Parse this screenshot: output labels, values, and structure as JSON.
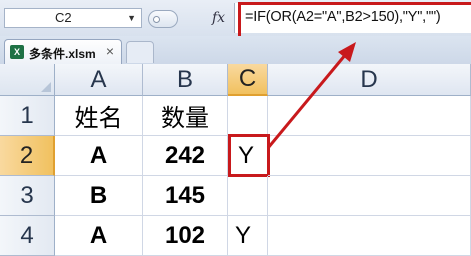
{
  "formula_bar": {
    "name_box": "C2",
    "fx_label": "fx",
    "formula": "=IF(OR(A2=\"A\",B2>150),\"Y\",\"\")"
  },
  "tabs": [
    {
      "label": "多条件.xlsm",
      "icon": "excel-file-icon"
    }
  ],
  "grid": {
    "columns": [
      "A",
      "B",
      "C",
      "D"
    ],
    "rows": [
      "1",
      "2",
      "3",
      "4"
    ],
    "cells": [
      [
        "姓名",
        "数量",
        "",
        ""
      ],
      [
        "A",
        "242",
        "Y",
        ""
      ],
      [
        "B",
        "145",
        "",
        ""
      ],
      [
        "A",
        "102",
        "Y",
        ""
      ]
    ],
    "active_cell": "C2"
  },
  "colors": {
    "highlight_red": "#c8191c",
    "active_header": "#f1c15f",
    "gridline": "#d0d7e5"
  }
}
